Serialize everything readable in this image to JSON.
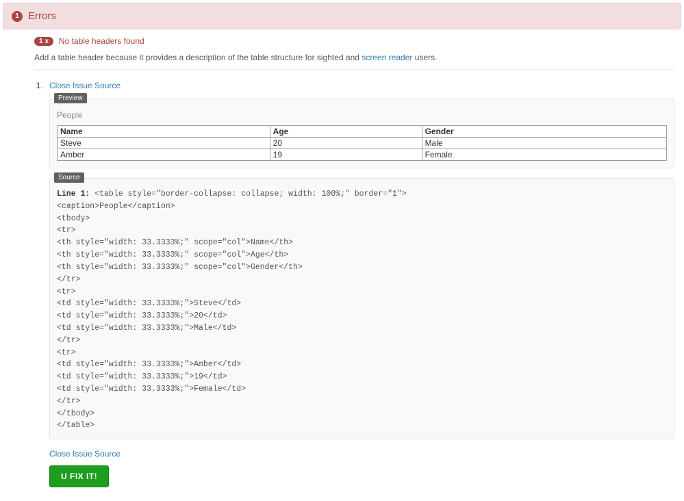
{
  "header": {
    "count": "1",
    "title": "Errors"
  },
  "issue": {
    "count_label": "1 x",
    "title": "No table headers found",
    "description_pre": "Add a table header because it provides a description of the table structure for sighted and ",
    "description_link": "screen reader",
    "description_post": " users.",
    "close_link": "Close Issue Source",
    "close_link_2": "Close Issue Source",
    "fix_button": "U FIX IT!"
  },
  "preview": {
    "label": "Preview",
    "caption": "People",
    "headers": [
      "Name",
      "Age",
      "Gender"
    ],
    "rows": [
      [
        "Steve",
        "20",
        "Male"
      ],
      [
        "Amber",
        "19",
        "Female"
      ]
    ]
  },
  "source": {
    "label": "Source",
    "line_label": "Line 1:",
    "lines": [
      "<table style=\"border-collapse: collapse; width: 100%;\" border=\"1\">",
      "<caption>People</caption>",
      "<tbody>",
      "<tr>",
      "<th style=\"width: 33.3333%;\" scope=\"col\">Name</th>",
      "<th style=\"width: 33.3333%;\" scope=\"col\">Age</th>",
      "<th style=\"width: 33.3333%;\" scope=\"col\">Gender</th>",
      "</tr>",
      "<tr>",
      "<td style=\"width: 33.3333%;\">Steve</td>",
      "<td style=\"width: 33.3333%;\">20</td>",
      "<td style=\"width: 33.3333%;\">Male</td>",
      "</tr>",
      "<tr>",
      "<td style=\"width: 33.3333%;\">Amber</td>",
      "<td style=\"width: 33.3333%;\">19</td>",
      "<td style=\"width: 33.3333%;\">Female</td>",
      "</tr>",
      "</tbody>",
      "</table>"
    ]
  }
}
